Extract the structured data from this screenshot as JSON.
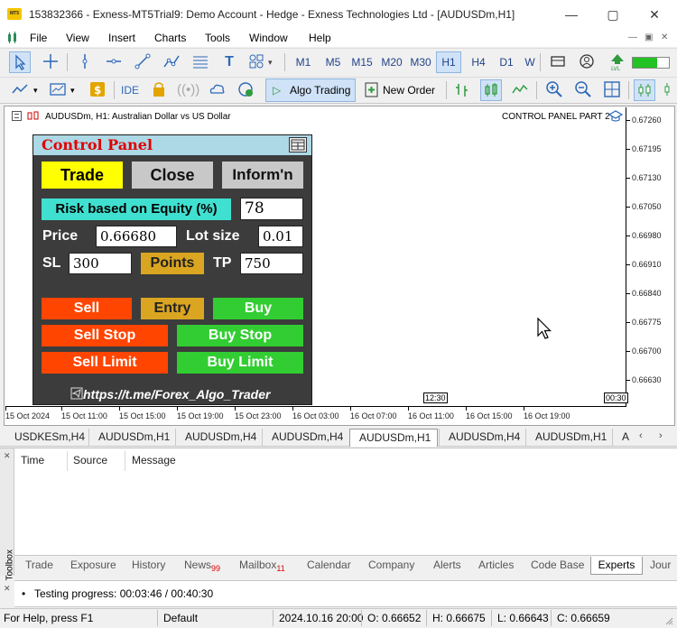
{
  "window": {
    "title": "153832366 - Exness-MT5Trial9: Demo Account - Hedge - Exness Technologies Ltd - [AUDUSDm,H1]",
    "icon_text": "MT5"
  },
  "menu": [
    "File",
    "View",
    "Insert",
    "Charts",
    "Tools",
    "Window",
    "Help"
  ],
  "timeframes": [
    "M1",
    "M5",
    "M15",
    "M20",
    "M30",
    "H1",
    "H4",
    "D1",
    "W"
  ],
  "active_timeframe": "H1",
  "toolbar2": {
    "ide": "IDE",
    "algo_trading": "Algo Trading",
    "new_order": "New Order"
  },
  "chart": {
    "symbol_line": "AUDUSDm, H1:  Australian Dollar vs US Dollar",
    "indicator_title": "CONTROL PANEL PART 2",
    "prices": [
      "0.67260",
      "0.67195",
      "0.67130",
      "0.67050",
      "0.66980",
      "0.66910",
      "0.66840",
      "0.66775",
      "0.66700",
      "0.66630"
    ],
    "times": [
      "15 Oct 2024",
      "15 Oct 11:00",
      "15 Oct 15:00",
      "15 Oct 19:00",
      "15 Oct 23:00",
      "16 Oct 03:00",
      "16 Oct 07:00",
      "16 Oct 11:00",
      "16 Oct 15:00",
      "16 Oct 19:00"
    ],
    "time_box_1": "12:30",
    "time_box_2": "00:30"
  },
  "control_panel": {
    "title": "Control Panel",
    "tab_trade": "Trade",
    "tab_close": "Close",
    "tab_inform": "Inform'n",
    "risk_label": "Risk based on Equity (%)",
    "risk_value": "78",
    "price_label": "Price",
    "price_value": "0.66680",
    "lot_label": "Lot size",
    "lot_value": "0.01",
    "sl_label": "SL",
    "sl_value": "300",
    "points_label": "Points",
    "tp_label": "TP",
    "tp_value": "750",
    "sell": "Sell",
    "entry": "Entry",
    "buy": "Buy",
    "sell_stop": "Sell Stop",
    "buy_stop": "Buy Stop",
    "sell_limit": "Sell Limit",
    "buy_limit": "Buy Limit",
    "link": "https://t.me/Forex_Algo_Trader",
    "colors": {
      "header": "#add8e6",
      "title": "#e00000",
      "trade_tab": "#ffff00",
      "risk_label_bg": "#40e0d0",
      "points_bg": "#daa520",
      "sell": "#ff4500",
      "buy": "#32cd32",
      "entry": "#daa520"
    }
  },
  "chart_tabs": [
    "USDKESm,H4",
    "AUDUSDm,H1",
    "AUDUSDm,H4",
    "AUDUSDm,H4",
    "AUDUSDm,H1",
    "AUDUSDm,H4",
    "AUDUSDm,H1",
    "A"
  ],
  "active_chart_tab": "AUDUSDm,H1",
  "toolbox": {
    "side_label": "Toolbox",
    "columns": [
      "Time",
      "Source",
      "Message"
    ],
    "tabs": [
      "Trade",
      "Exposure",
      "History",
      "News",
      "Mailbox",
      "Calendar",
      "Company",
      "Alerts",
      "Articles",
      "Code Base",
      "Experts",
      "Jour"
    ],
    "news_badge": "99",
    "mailbox_badge": "11",
    "active_tab": "Experts"
  },
  "tester": {
    "bullet": "•",
    "progress": "Testing progress: 00:03:46 / 00:40:30"
  },
  "status": {
    "help": "For Help, press F1",
    "profile": "Default",
    "datetime": "2024.10.16 20:00",
    "open": "O: 0.66652",
    "high": "H: 0.66675",
    "low": "L: 0.66643",
    "close": "C: 0.66659"
  }
}
